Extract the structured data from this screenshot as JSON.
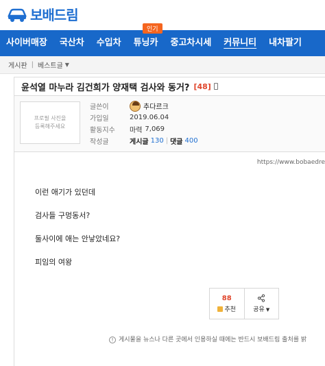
{
  "logo": {
    "text": "보배드림",
    "icon": "car-icon",
    "brand_color": "#1f6fd1"
  },
  "nav": {
    "bg_color": "#1868c9",
    "hot_badge": "인기",
    "items": [
      {
        "label": "사이버매장"
      },
      {
        "label": "국산차"
      },
      {
        "label": "수입차"
      },
      {
        "label": "튜닝카"
      },
      {
        "label": "중고차시세"
      },
      {
        "label": "커뮤니티",
        "active": true
      },
      {
        "label": "내차팔기"
      }
    ]
  },
  "breadcrumb": {
    "root": "게시판",
    "current": "베스트글",
    "caret_icon": "caret-down-icon"
  },
  "post": {
    "title": "윤석열 마누라 김건희가 양재택 검사와 동거?",
    "comment_count": "[48]",
    "mobile_icon": "mobile-icon"
  },
  "profile": {
    "photo_placeholder": "프로필 사진을\n등록해주세요",
    "labels": {
      "writer": "글쓴이",
      "joined": "가입일",
      "activity": "활동지수",
      "posts": "작성글"
    },
    "nickname": "추다르크",
    "join_date": "2019.06.04",
    "mileage_label": "마력",
    "mileage_value": "7,069",
    "post_label": "게시글",
    "post_count": "130",
    "comment_label": "댓글",
    "comment_count": "400"
  },
  "content": {
    "source_url": "https://www.bobaedre",
    "lines": [
      "이런 애기가 있던데",
      "검사들 구멍동서?",
      "둘사이에 애는 안낳았네요?",
      "피임의 여왕"
    ]
  },
  "actions": {
    "recommend_count": "88",
    "recommend_label": "추천",
    "share_label": "공유",
    "thumb_icon": "thumbs-up-icon",
    "share_icon": "share-icon"
  },
  "notice": {
    "icon": "info-icon",
    "text": "게시물을 뉴스나 다른 곳에서 인용하실 때에는 반드시 보배드림 출처를 밝"
  }
}
